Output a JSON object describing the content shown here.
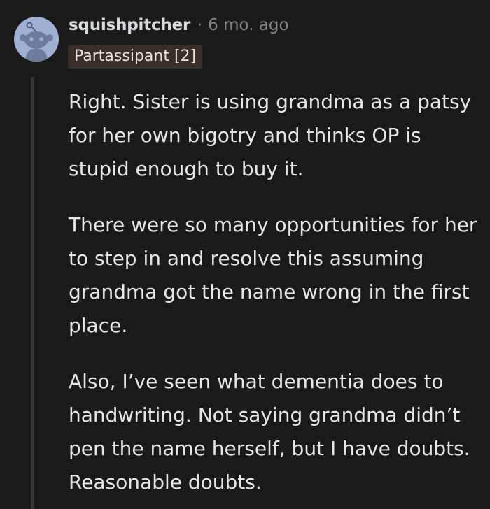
{
  "comment": {
    "username": "squishpitcher",
    "separator": "·",
    "timestamp": "6 mo. ago",
    "flair": "Partassipant [2]",
    "paragraphs": [
      "Right. Sister is using grandma as a patsy for her own bigotry and thinks OP is stupid enough to buy it.",
      "There were so many opportunities for her to step in and resolve this assuming grandma got the name wrong in the first place.",
      "Also, I’ve seen what dementia does to handwriting. Not saying grandma didn’t pen the name herself, but I have doubts. Reasonable doubts."
    ]
  },
  "icons": {
    "avatar": "snoo-avatar-icon"
  },
  "colors": {
    "background": "#1a1a1b",
    "username": "#d7dadc",
    "meta": "#818384",
    "body_text": "#e4e6e8",
    "flair_background": "#3a2e28",
    "avatar_background": "#9fb0d4",
    "thread_line": "#343536"
  }
}
